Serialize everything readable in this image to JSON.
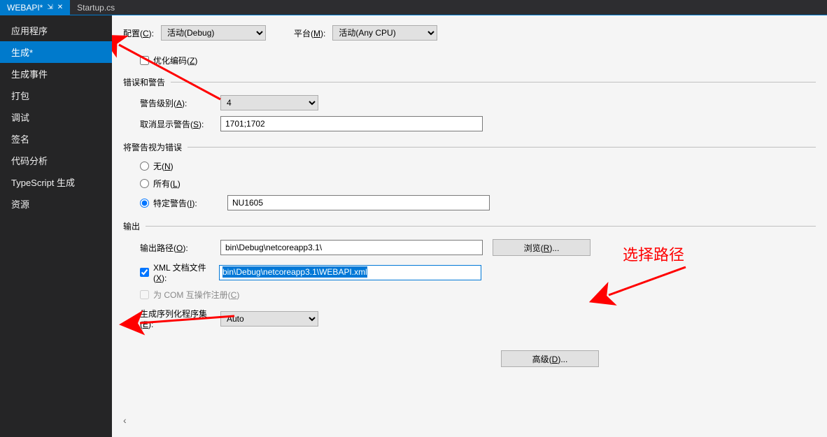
{
  "tabs": [
    {
      "label": "WEBAPI*",
      "active": true
    },
    {
      "label": "Startup.cs",
      "active": false
    }
  ],
  "sidebar": {
    "items": [
      "应用程序",
      "生成*",
      "生成事件",
      "打包",
      "调试",
      "签名",
      "代码分析",
      "TypeScript 生成",
      "资源"
    ],
    "selectedIndex": 1
  },
  "top": {
    "configLabel": "配置(C):",
    "configValue": "活动(Debug)",
    "platformLabel": "平台(M):",
    "platformValue": "活动(Any CPU)"
  },
  "general": {
    "optimizeLabel": "优化编码(Z)",
    "optimizeChecked": false
  },
  "errors": {
    "sectionTitle": "错误和警告",
    "warnLevelLabel": "警告级别(A):",
    "warnLevelValue": "4",
    "suppressLabel": "取消显示警告(S):",
    "suppressValue": "1701;1702"
  },
  "treatAsErrors": {
    "sectionTitle": "将警告视为错误",
    "noneLabel": "无(N)",
    "allLabel": "所有(L)",
    "specificLabel": "特定警告(I):",
    "specificValue": "NU1605",
    "selected": "specific"
  },
  "output": {
    "sectionTitle": "输出",
    "outPathLabel": "输出路径(O):",
    "outPathValue": "bin\\Debug\\netcoreapp3.1\\",
    "browseLabel": "浏览(R)...",
    "xmlDocLabel": "XML 文档文件(X):",
    "xmlDocChecked": true,
    "xmlDocValue": "bin\\Debug\\netcoreapp3.1\\WEBAPI.xml",
    "comLabel": "为 COM 互操作注册(C)",
    "comChecked": false,
    "serialLabel": "生成序列化程序集(E):",
    "serialValue": "Auto",
    "advancedLabel": "高级(D)..."
  },
  "annotation": {
    "selectPath": "选择路径"
  }
}
